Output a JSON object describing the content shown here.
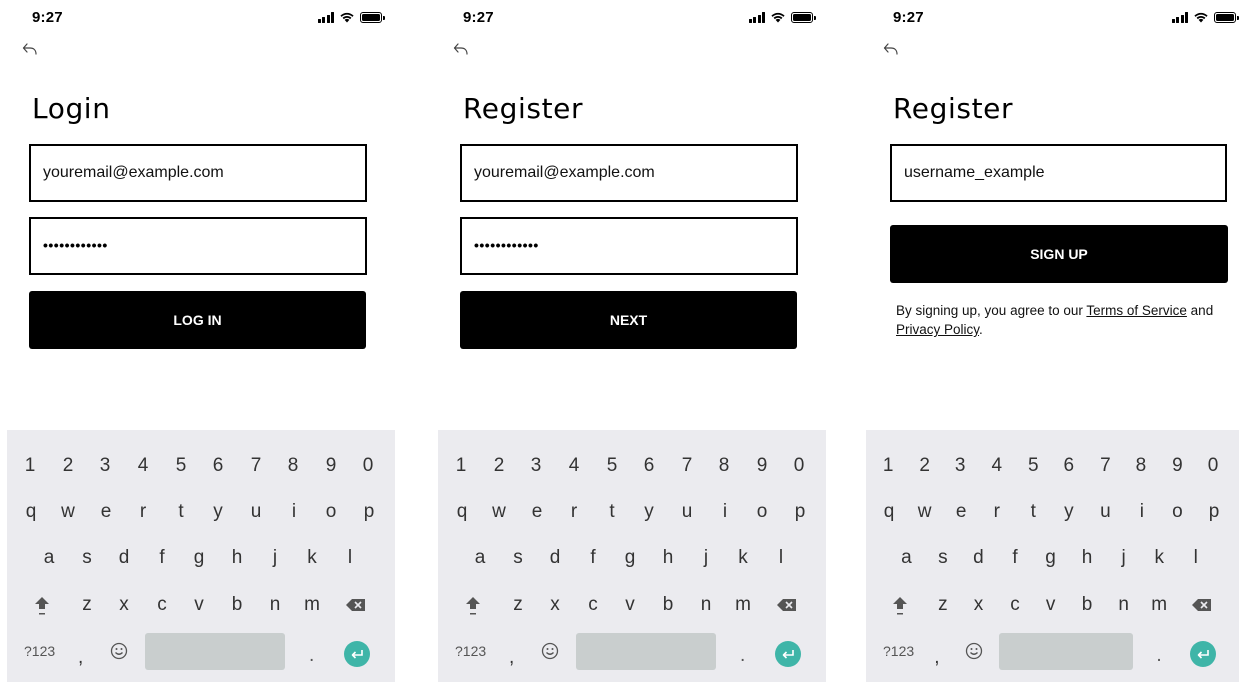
{
  "status": {
    "time": "9:27"
  },
  "login": {
    "title": "Login",
    "email_value": "youremail@example.com",
    "password_mask": "••••••••••••",
    "button_label": "LOG IN"
  },
  "register_step1": {
    "title": "Register",
    "email_value": "youremail@example.com",
    "password_mask": "••••••••••••",
    "button_label": "NEXT"
  },
  "register_step2": {
    "title": "Register",
    "username_value": "username_example",
    "button_label": "SIGN UP",
    "legal_prefix": "By signing up, you agree to our ",
    "terms_link": "Terms of Service",
    "legal_and": " and ",
    "privacy_link": "Privacy Policy",
    "legal_suffix": "."
  },
  "keyboard": {
    "numbers": [
      "1",
      "2",
      "3",
      "4",
      "5",
      "6",
      "7",
      "8",
      "9",
      "0"
    ],
    "row_q": [
      "q",
      "w",
      "e",
      "r",
      "t",
      "y",
      "u",
      "i",
      "o",
      "p"
    ],
    "row_a": [
      "a",
      "s",
      "d",
      "f",
      "g",
      "h",
      "j",
      "k",
      "l"
    ],
    "row_z": [
      "z",
      "x",
      "c",
      "v",
      "b",
      "n",
      "m"
    ],
    "symbols_label": "?123",
    "comma": ",",
    "period": ".",
    "enter_color": "#3fb5a8"
  }
}
